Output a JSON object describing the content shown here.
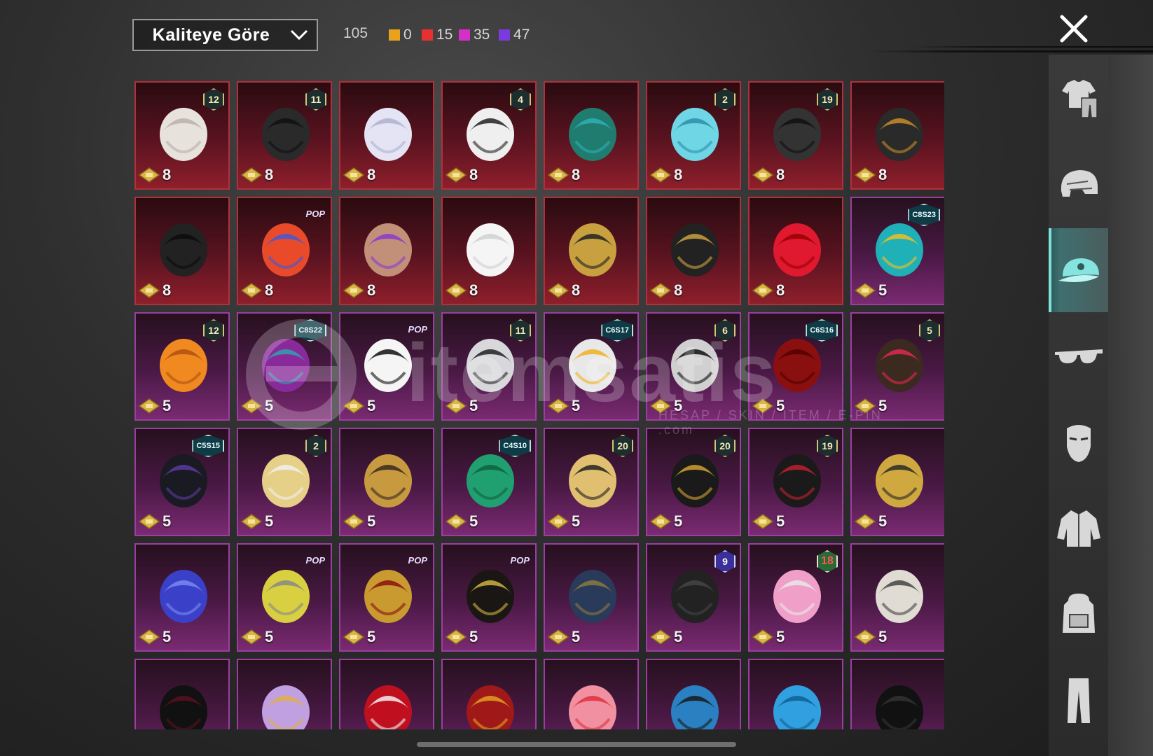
{
  "toolbar": {
    "sort_label": "Kaliteye Göre",
    "total_count": "105",
    "rarity_counts": [
      {
        "color": "#e8a21c",
        "count": "0"
      },
      {
        "color": "#e83030",
        "count": "15"
      },
      {
        "color": "#d62fc8",
        "count": "35"
      },
      {
        "color": "#7a3ae0",
        "count": "47"
      }
    ]
  },
  "sidebar": {
    "tabs": [
      {
        "name": "outfit",
        "icon": "outfit-icon"
      },
      {
        "name": "helmet",
        "icon": "helmet-icon"
      },
      {
        "name": "hat",
        "icon": "cap-icon",
        "active": true
      },
      {
        "name": "glasses",
        "icon": "glasses-icon"
      },
      {
        "name": "mask",
        "icon": "mask-icon"
      },
      {
        "name": "jacket",
        "icon": "jacket-icon"
      },
      {
        "name": "backpack",
        "icon": "backpack-icon"
      },
      {
        "name": "pants",
        "icon": "pants-icon"
      }
    ]
  },
  "items": [
    {
      "tier": "red",
      "art": "white-hair",
      "badge": "12",
      "price": "8"
    },
    {
      "tier": "red",
      "art": "black-hair",
      "badge": "11",
      "price": "8"
    },
    {
      "tier": "red",
      "art": "silver-hair",
      "badge": "",
      "price": "8"
    },
    {
      "tier": "red",
      "art": "snowman-hat",
      "badge": "4",
      "price": "8"
    },
    {
      "tier": "red",
      "art": "dragon-helm",
      "badge": "",
      "price": "8"
    },
    {
      "tier": "red",
      "art": "cyan-bucket-hat",
      "badge": "2",
      "price": "8"
    },
    {
      "tier": "red",
      "art": "dark-helmet",
      "badge": "19",
      "price": "8"
    },
    {
      "tier": "red",
      "art": "dark-knight-helm",
      "badge": "",
      "price": "8"
    },
    {
      "tier": "red",
      "art": "black-samurai-helm",
      "badge": "",
      "price": "8"
    },
    {
      "tier": "red",
      "art": "mecha-helm",
      "badge": "POP",
      "price": "8"
    },
    {
      "tier": "red",
      "art": "purple-cap-hair",
      "badge": "",
      "price": "8"
    },
    {
      "tier": "red",
      "art": "ghost-hood",
      "badge": "",
      "price": "8"
    },
    {
      "tier": "red",
      "art": "pharaoh-gold",
      "badge": "",
      "price": "8"
    },
    {
      "tier": "red",
      "art": "pharaoh-dark",
      "badge": "",
      "price": "8"
    },
    {
      "tier": "red",
      "art": "red-ribbon",
      "badge": "",
      "price": "8"
    },
    {
      "tier": "purple",
      "art": "cat-headphones",
      "badge": "C8S23",
      "price": "5"
    },
    {
      "tier": "purple",
      "art": "orange-hair",
      "badge": "12",
      "price": "5"
    },
    {
      "tier": "purple",
      "art": "purple-hair",
      "badge": "C8S22",
      "price": "5"
    },
    {
      "tier": "purple",
      "art": "panda-mask",
      "badge": "POP",
      "price": "5"
    },
    {
      "tier": "purple",
      "art": "flower-hair",
      "badge": "11",
      "price": "5"
    },
    {
      "tier": "purple",
      "art": "fur-visor",
      "badge": "C6S17",
      "price": "5"
    },
    {
      "tier": "purple",
      "art": "winged-helm",
      "badge": "6",
      "price": "5"
    },
    {
      "tier": "purple",
      "art": "red-hair",
      "badge": "C6S16",
      "price": "5"
    },
    {
      "tier": "purple",
      "art": "bow-hair",
      "badge": "5",
      "price": "5"
    },
    {
      "tier": "purple",
      "art": "black-cap",
      "badge": "C5S15",
      "price": "5"
    },
    {
      "tier": "purple",
      "art": "maid-hair",
      "badge": "2",
      "price": "5"
    },
    {
      "tier": "purple",
      "art": "gold-horn-helm",
      "badge": "",
      "price": "5"
    },
    {
      "tier": "purple",
      "art": "green-armor-helm",
      "badge": "C4S10",
      "price": "5"
    },
    {
      "tier": "purple",
      "art": "bunny-hat-hair",
      "badge": "20",
      "price": "5"
    },
    {
      "tier": "purple",
      "art": "gold-black-mask",
      "badge": "20",
      "price": "5"
    },
    {
      "tier": "purple",
      "art": "black-bun-hair",
      "badge": "19",
      "price": "5"
    },
    {
      "tier": "purple",
      "art": "gold-crown-hair",
      "badge": "",
      "price": "5"
    },
    {
      "tier": "purple",
      "art": "blue-demon",
      "badge": "",
      "price": "5"
    },
    {
      "tier": "purple",
      "art": "yellow-knight-helm",
      "badge": "POP",
      "price": "5"
    },
    {
      "tier": "purple",
      "art": "gold-moto-helm",
      "badge": "POP",
      "price": "5"
    },
    {
      "tier": "purple",
      "art": "black-long-hair",
      "badge": "POP",
      "price": "5"
    },
    {
      "tier": "purple",
      "art": "navy-hood",
      "badge": "",
      "price": "5"
    },
    {
      "tier": "purple",
      "art": "black-jelly-helm",
      "badge": "9",
      "price": "5"
    },
    {
      "tier": "purple",
      "art": "pink-headset-cap",
      "badge": "18",
      "price": "5"
    },
    {
      "tier": "purple",
      "art": "dread-lion",
      "badge": "",
      "price": "5"
    },
    {
      "tier": "purple",
      "art": "top-hat",
      "badge": "",
      "price": ""
    },
    {
      "tier": "purple",
      "art": "jewel-cap-hair",
      "badge": "",
      "price": ""
    },
    {
      "tier": "purple",
      "art": "jester-crown",
      "badge": "",
      "price": ""
    },
    {
      "tier": "purple",
      "art": "red-curly-crown",
      "badge": "",
      "price": ""
    },
    {
      "tier": "purple",
      "art": "strawberry-cap",
      "badge": "",
      "price": ""
    },
    {
      "tier": "purple",
      "art": "blue-goggle-helm",
      "badge": "",
      "price": ""
    },
    {
      "tier": "purple",
      "art": "blue-spiky-hair",
      "badge": "",
      "price": ""
    },
    {
      "tier": "purple",
      "art": "black-fedora",
      "badge": "",
      "price": ""
    }
  ],
  "watermark": {
    "word": "itemsatis",
    "sub": "HESAP / SKIN / ITEM / E-PIN .com"
  }
}
